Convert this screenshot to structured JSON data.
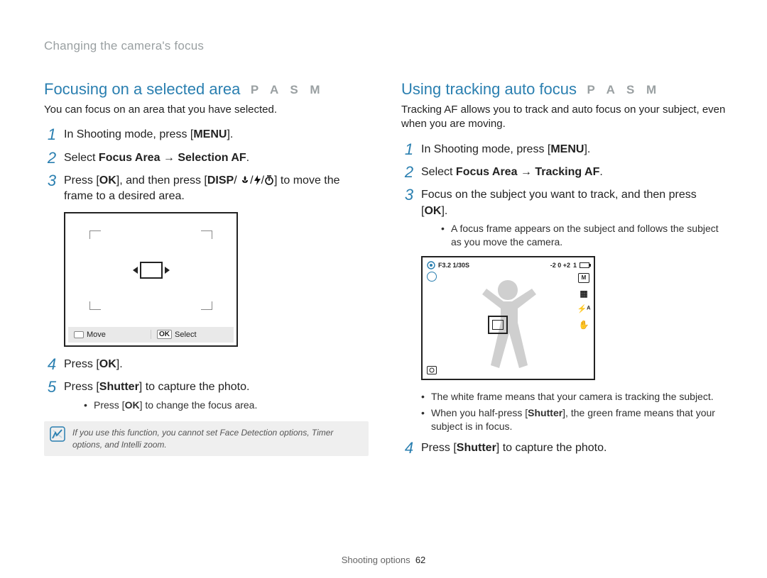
{
  "breadcrumb": "Changing the camera's focus",
  "footer": {
    "section": "Shooting options",
    "page": "62"
  },
  "left": {
    "title": "Focusing on a selected area",
    "modes": "P A S M",
    "intro": "You can focus on an area that you have selected.",
    "step1_a": "In Shooting mode, press [",
    "step1_btn": "MENU",
    "step1_b": "].",
    "step2_a": "Select ",
    "step2_b1": "Focus Area",
    "step2_arrow": " → ",
    "step2_b2": "Selection AF",
    "step2_c": ".",
    "step3_a": "Press [",
    "step3_ok": "OK",
    "step3_b": "], and then press [",
    "step3_disp": "DISP",
    "step3_sep": "/",
    "step3_c": "] to move the frame to a desired area.",
    "screen_move": "Move",
    "screen_ok": "OK",
    "screen_select": "Select",
    "step4_a": "Press [",
    "step4_ok": "OK",
    "step4_b": "].",
    "step5_a": "Press [",
    "step5_shutter": "Shutter",
    "step5_b": "] to capture the photo.",
    "sub1_a": "Press [",
    "sub1_ok": "OK",
    "sub1_b": "] to change the focus area.",
    "note": "If you use this function, you cannot set Face Detection options, Timer options, and Intelli zoom."
  },
  "right": {
    "title": "Using tracking auto focus",
    "modes": "P A S M",
    "intro": "Tracking AF allows you to track and auto focus on your subject, even when you are moving.",
    "step1_a": "In Shooting mode, press [",
    "step1_btn": "MENU",
    "step1_b": "].",
    "step2_a": "Select ",
    "step2_b1": "Focus Area",
    "step2_arrow": " → ",
    "step2_b2": "Tracking AF",
    "step2_c": ".",
    "step3_a": "Focus on the subject you want to track, and then press [",
    "step3_ok": "OK",
    "step3_b": "].",
    "sub_a": "A focus frame appears on the subject and follows the subject as you move the camera.",
    "screen_top": "F3.2  1/30S",
    "screen_exp": "-2  0  +2",
    "screen_count": "1",
    "icon_m": "M",
    "icon_flash": "⚡ᴬ",
    "icon_hand": "✋",
    "sub_b_a": "The white frame means that your camera is tracking the subject.",
    "sub_c_a": "When you half-press [",
    "sub_c_shutter": "Shutter",
    "sub_c_b": "], the green frame means that your subject is in focus.",
    "step4_a": "Press [",
    "step4_shutter": "Shutter",
    "step4_b": "] to capture the photo."
  }
}
